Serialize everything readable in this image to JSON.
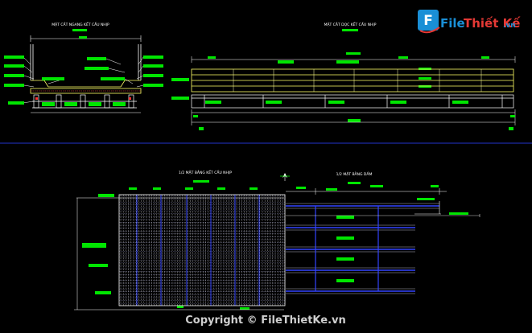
{
  "titles": {
    "cross_section": "MẶT CẮT NGANG KẾT CẤU NHỊP",
    "long_section": "MẶT CẮT DỌC KẾT CẤU NHỊP",
    "half_plan_deck": "1/2 MẶT BẰNG KẾT CẤU NHỊP",
    "half_plan_beam": "1/2 MẶT BẰNG DẦM"
  },
  "watermark": {
    "logo_part1": "File",
    "logo_part2": "Thiết Kế",
    "logo_suffix": ".vn",
    "copyright": "Copyright © FileThietKe.vn"
  },
  "colors": {
    "background": "#000000",
    "annotation_tag": "#00e600",
    "structure": "#ffff66",
    "line_white": "#ffffff",
    "beam_blue": "#3344ff",
    "logo_blue": "#1a8fd6",
    "logo_red": "#e53935"
  },
  "icons": [
    "north-arrow-icon",
    "filethietke-logo-icon"
  ]
}
